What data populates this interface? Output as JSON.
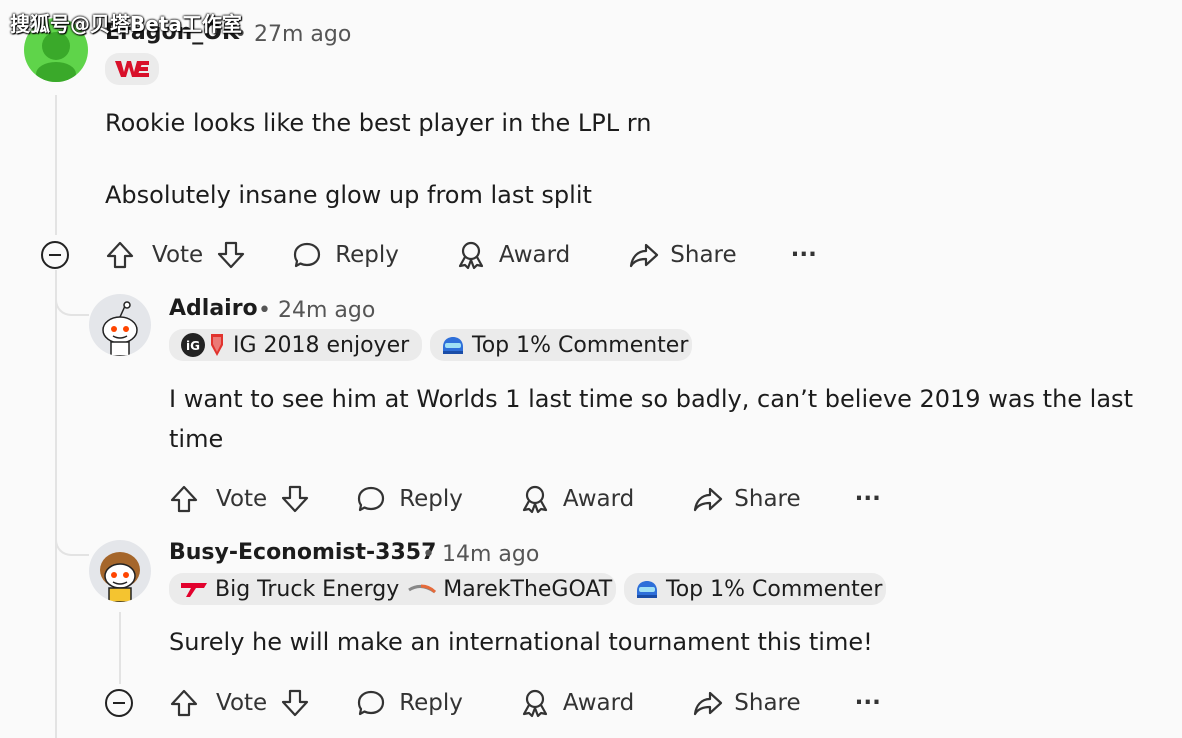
{
  "watermark": "搜狐号@贝塔Beta工作室",
  "comments": [
    {
      "username": "Eragon_OK",
      "time": "27m ago",
      "flair_logo": "WE",
      "paragraphs": [
        "Rookie looks like the best player in the LPL rn",
        "Absolutely insane glow up from last split"
      ]
    },
    {
      "username": "Adlairo",
      "time": "24m ago",
      "flairs": [
        "IG 2018 enjoyer",
        "Top 1% Commenter"
      ],
      "paragraphs": [
        "I want to see him at Worlds 1 last time so badly, can’t believe 2019 was the last time"
      ]
    },
    {
      "username": "Busy-Economist-3357",
      "time": "14m ago",
      "flairs": [
        "Big Truck Energy",
        "MarekTheGOAT",
        "Top 1% Commenter"
      ],
      "paragraphs": [
        "Surely he will make an international tournament this time!"
      ]
    }
  ],
  "actions": {
    "vote": "Vote",
    "reply": "Reply",
    "award": "Award",
    "share": "Share",
    "more": "···"
  },
  "separator": "•",
  "colors": {
    "background": "#fafafa",
    "flair_bg": "#ebebeb",
    "thread_line": "#e3e3e3",
    "we_red": "#d8102a"
  }
}
